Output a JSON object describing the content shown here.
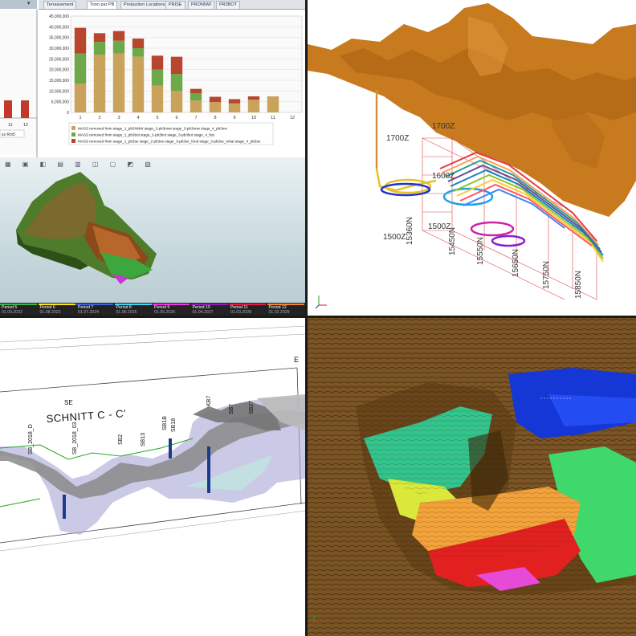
{
  "tabs": [
    "Terrassement",
    "Tonn par PB",
    "Production Locations",
    "PRISE",
    "PRONNW",
    "PR3BOT"
  ],
  "active_tab": 1,
  "left_panel": {
    "label": "ss Rm5",
    "tick_labels": [
      "11",
      "12"
    ]
  },
  "chart_data": {
    "type": "bar",
    "categories": [
      "1",
      "2",
      "3",
      "4",
      "5",
      "6",
      "7",
      "8",
      "9",
      "10",
      "11",
      "12"
    ],
    "ylim": [
      0,
      45000000
    ],
    "yticks": [
      "45,000,000",
      "40,000,000",
      "35,000,000",
      "30,000,000",
      "25,000,000",
      "20,000,000",
      "15,000,000",
      "10,000,000",
      "5,000,000",
      "0"
    ],
    "series": [
      {
        "name": "MASS removed from stage_1_pb3NNW stage_2-pb3nnw stage_3-pb3nnw stage_4_pb3nw",
        "color": "#c9a35b",
        "values": [
          13500000,
          27000000,
          27500000,
          26000000,
          12500000,
          10000000,
          5500000,
          4800000,
          4200000,
          6000000,
          7500000,
          0
        ]
      },
      {
        "name": "MASS removed from stage_1_pb3bot stage_2-pb3bot stage_3-pb3bot stage_4_bot",
        "color": "#6fa84a",
        "values": [
          14000000,
          6000000,
          6000000,
          4000000,
          7500000,
          8000000,
          3500000,
          0,
          0,
          0,
          0,
          0
        ]
      },
      {
        "name": "MASS removed from stage_1_pb3se stage_2-pb3se stage_3-pb3se_fond stage_3-pb3se_rekat stage_4_pb3se",
        "color": "#b8452e",
        "values": [
          12000000,
          4000000,
          4500000,
          4500000,
          6500000,
          8000000,
          2000000,
          2500000,
          2000000,
          1500000,
          0,
          0
        ]
      }
    ]
  },
  "view3d": {
    "z_labels": [
      "1700Z",
      "1700Z",
      "1600Z",
      "1500Z",
      "1500Z"
    ],
    "n_labels": [
      "15360N",
      "15450N",
      "15550N",
      "15650N",
      "15750N",
      "15850N"
    ]
  },
  "periods": [
    {
      "label": "Period 5",
      "date": "01.09.2022",
      "color": "#3cb44b"
    },
    {
      "label": "Period 6",
      "date": "01.08.2023",
      "color": "#ffe119"
    },
    {
      "label": "Period 7",
      "date": "01.07.2024",
      "color": "#4363d8"
    },
    {
      "label": "Period 8",
      "date": "01.06.2025",
      "color": "#42d4f4"
    },
    {
      "label": "Period 9",
      "date": "01.05.2026",
      "color": "#f032e6"
    },
    {
      "label": "Period 10",
      "date": "01.04.2027",
      "color": "#911eb4"
    },
    {
      "label": "Period 11",
      "date": "01.03.2028",
      "color": "#e6194b"
    },
    {
      "label": "Period 12",
      "date": "01.02.2029",
      "color": "#f58231"
    }
  ],
  "section": {
    "title": "SCHNITT C - C'",
    "se_label": "SE",
    "e_label": "E",
    "boreholes": [
      "SB_2018_D",
      "SB_2018_03",
      "SB2",
      "SB13",
      "SB1B",
      "SB18",
      "KB7",
      "SB7",
      "SB27"
    ]
  }
}
